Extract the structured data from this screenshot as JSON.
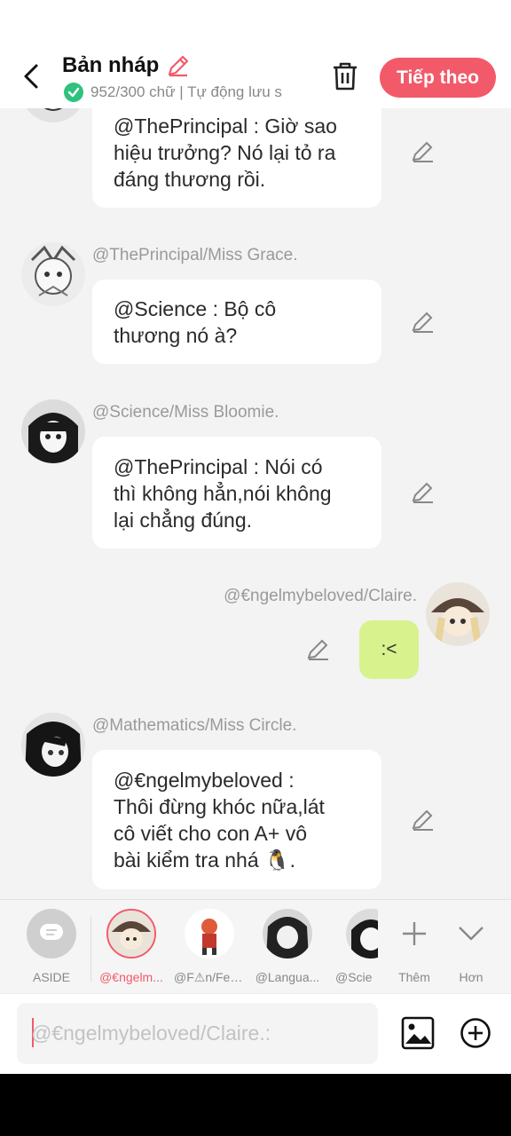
{
  "header": {
    "title": "Bản nháp",
    "status": "952/300 chữ | Tự động lưu s",
    "next_label": "Tiếp theo"
  },
  "messages": [
    {
      "lines": [
        "@ThePrincipal : Giờ sao",
        "hiệu trưởng? Nó lại tỏ ra",
        "đáng thương rồi."
      ]
    },
    {
      "author": "@ThePrincipal/Miss Grace.",
      "lines": [
        "@Science : Bộ cô",
        "thương nó à?"
      ]
    },
    {
      "author": "@Science/Miss Bloomie.",
      "lines": [
        "@ThePrincipal : Nói có",
        "thì không hẳn,nói không",
        "lại chẳng đúng."
      ]
    },
    {
      "author": "@€ngelmybeloved/Claire.",
      "text": ":<"
    },
    {
      "author": "@Mathematics/Miss Circle.",
      "lines": [
        "@€ngelmybeloved :",
        "Thôi đừng khóc nữa,lát",
        "cô viết cho con A+ vô",
        "bài kiểm tra nhá 🐧."
      ]
    }
  ],
  "characters": [
    {
      "label": "ASIDE"
    },
    {
      "label": "@€ngelm..."
    },
    {
      "label": "@F⚠n/Fen..."
    },
    {
      "label": "@Langua..."
    },
    {
      "label": "@Scie"
    }
  ],
  "actions": {
    "add_label": "Thêm",
    "more_label": "Hơn"
  },
  "composer": {
    "placeholder": "@€ngelmybeloved/Claire.:"
  },
  "colors": {
    "accent": "#f25a6a",
    "self_bubble": "#d8f28e",
    "check": "#2ec27e"
  }
}
